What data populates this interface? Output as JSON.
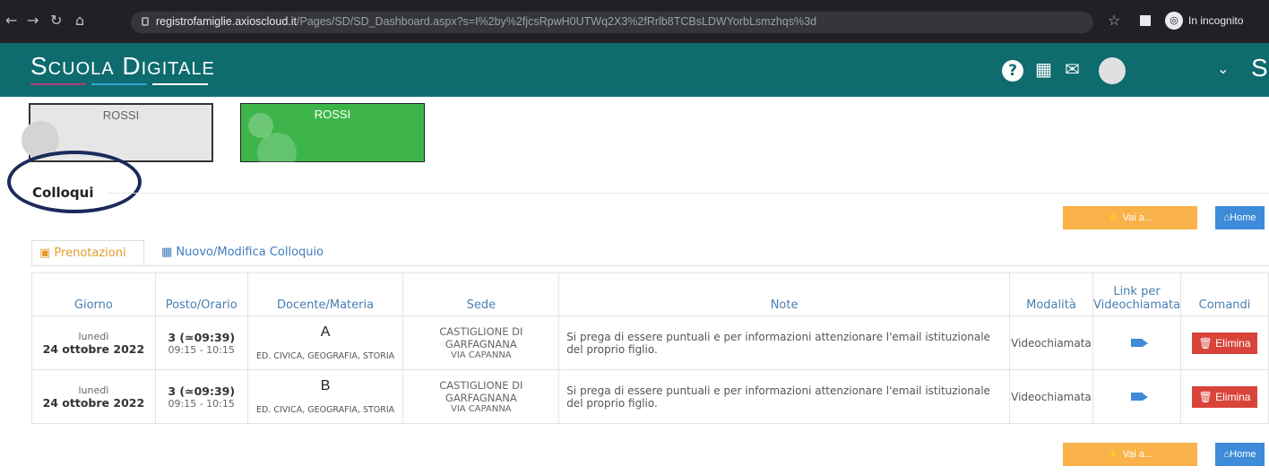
{
  "browser": {
    "url_host": "registrofamiglie.axioscloud.it",
    "url_path": "/Pages/SD/SD_Dashboard.aspx?s=I%2by%2fjcsRpwH0UTWq2X3%2fRrlb8TCBsLDWYorbLsmzhqs%3d",
    "incognito_label": "In incognito"
  },
  "app": {
    "logo": "Scuola Digitale",
    "logo_line_colors": [
      "#b03a7a",
      "#3aa0d8",
      "#ffffff"
    ],
    "brand_color": "#0e6b6e",
    "header_cut_text": "Sp"
  },
  "students": [
    {
      "name": "ROSSI",
      "color": "#e6e6e6"
    },
    {
      "name": "ROSSI",
      "color": "#3db54a"
    }
  ],
  "section": {
    "title": "Colloqui"
  },
  "buttons": {
    "vai": "Vai a...",
    "home": "Home",
    "delete": "Elimina"
  },
  "tabs": [
    {
      "label": "Prenotazioni",
      "active": true
    },
    {
      "label": "Nuovo/Modifica Colloquio",
      "active": false
    }
  ],
  "table": {
    "headers": [
      "Giorno",
      "Posto/Orario",
      "Docente/Materia",
      "Sede",
      "Note",
      "Modalità",
      "Link per Videochiamata",
      "Comandi"
    ],
    "rows": [
      {
        "weekday": "lunedì",
        "date": "24 ottobre 2022",
        "posto": "3 (≃09:39)",
        "orario": "09:15 - 10:15",
        "docente": "A",
        "materia": "ED. CIVICA, GEOGRAFIA, STORIA",
        "sede": "CASTIGLIONE DI GARFAGNANA",
        "indirizzo": "VIA CAPANNA",
        "note": "Si prega di essere puntuali e per informazioni attenzionare l'email istituzionale del proprio figlio.",
        "modalita": "Videochiamata"
      },
      {
        "weekday": "lunedì",
        "date": "24 ottobre 2022",
        "posto": "3 (≃09:39)",
        "orario": "09:15 - 10:15",
        "docente": "B",
        "materia": "ED. CIVICA, GEOGRAFIA, STORIA",
        "sede": "CASTIGLIONE DI GARFAGNANA",
        "indirizzo": "VIA CAPANNA",
        "note": "Si prega di essere puntuali e per informazioni attenzionare l'email istituzionale del proprio figlio.",
        "modalita": "Videochiamata"
      }
    ]
  }
}
